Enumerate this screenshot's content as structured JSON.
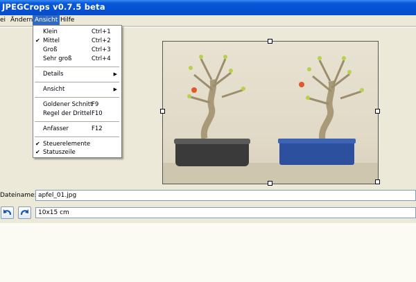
{
  "window": {
    "title": "JPEGCrops v0.7.5 beta"
  },
  "menubar": {
    "items": [
      "ei",
      "Ändern",
      "Ansicht",
      "Hilfe"
    ]
  },
  "ansicht_menu": {
    "groups": [
      [
        {
          "label": "Klein",
          "shortcut": "Ctrl+1",
          "checked": false
        },
        {
          "label": "Mittel",
          "shortcut": "Ctrl+2",
          "checked": true
        },
        {
          "label": "Groß",
          "shortcut": "Ctrl+3",
          "checked": false
        },
        {
          "label": "Sehr groß",
          "shortcut": "Ctrl+4",
          "checked": false
        }
      ],
      [
        {
          "label": "Details",
          "submenu": true
        }
      ],
      [
        {
          "label": "Ansicht",
          "submenu": true
        }
      ],
      [
        {
          "label": "Goldener Schnitt",
          "shortcut": "F9"
        },
        {
          "label": "Regel der Drittel",
          "shortcut": "F10"
        }
      ],
      [
        {
          "label": "Anfasser",
          "shortcut": "F12"
        }
      ],
      [
        {
          "label": "Steuerelemente",
          "checked": true
        },
        {
          "label": "Statuszeile",
          "checked": true
        }
      ]
    ]
  },
  "filename": {
    "label": "Dateiname:",
    "value": "apfel_01.jpg"
  },
  "format": {
    "value": "10x15 cm"
  },
  "colors": {
    "titlebar": "#0450d2",
    "menu_highlight": "#316ac5",
    "pot_left": "#3a3a3a",
    "pot_right": "#2c4f9e"
  }
}
